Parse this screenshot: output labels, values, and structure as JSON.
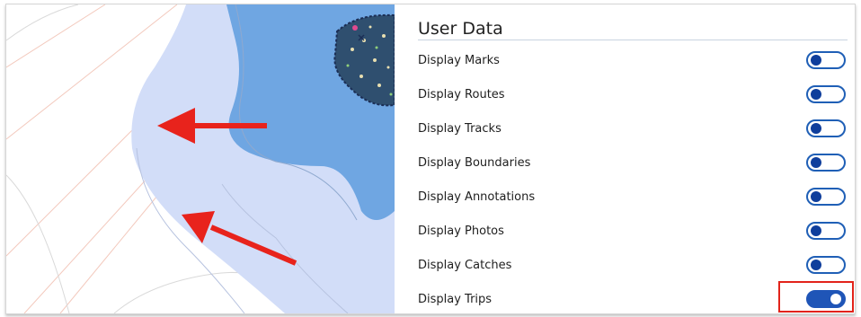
{
  "panel": {
    "title": "User Data",
    "items": [
      {
        "label": "Display Marks",
        "on": false
      },
      {
        "label": "Display Routes",
        "on": false
      },
      {
        "label": "Display Tracks",
        "on": false
      },
      {
        "label": "Display Boundaries",
        "on": false
      },
      {
        "label": "Display Annotations",
        "on": false
      },
      {
        "label": "Display Photos",
        "on": false
      },
      {
        "label": "Display Catches",
        "on": false
      },
      {
        "label": "Display Trips",
        "on": true
      }
    ]
  },
  "colors": {
    "toggle_on": "#1f55b7",
    "toggle_off_border": "#1f5fb6",
    "highlight": "#e2231a",
    "arrow": "#e8231c",
    "shallow_water": "#d2ddf8",
    "deep_water": "#6fa6e2",
    "land": "#2f4f6f"
  }
}
